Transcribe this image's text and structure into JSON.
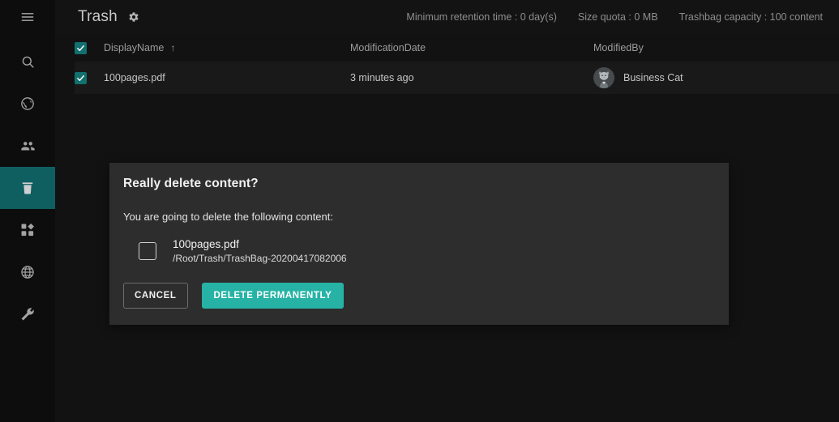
{
  "sidebar": {
    "items": [
      {
        "icon": "hamburger-menu-icon",
        "name": "menu-toggle",
        "label": "Menu",
        "active": false
      },
      {
        "icon": "search-icon",
        "name": "sidebar-item-search",
        "label": "Search",
        "active": false
      },
      {
        "icon": "globe-explore-icon",
        "name": "sidebar-item-explore",
        "label": "Explore",
        "active": false
      },
      {
        "icon": "people-icon",
        "name": "sidebar-item-users",
        "label": "Users",
        "active": false
      },
      {
        "icon": "trash-icon",
        "name": "sidebar-item-trash",
        "label": "Trash",
        "active": true
      },
      {
        "icon": "dashboard-icon",
        "name": "sidebar-item-dashboard",
        "label": "Dashboard",
        "active": false
      },
      {
        "icon": "language-globe-icon",
        "name": "sidebar-item-language",
        "label": "Language",
        "active": false
      },
      {
        "icon": "wrench-icon",
        "name": "sidebar-item-setup",
        "label": "Setup",
        "active": false
      }
    ]
  },
  "header": {
    "title": "Trash",
    "gear_icon": "gear-icon",
    "stats": [
      "Minimum retention time : 0 day(s)",
      "Size quota : 0 MB",
      "Trashbag capacity : 100 content"
    ]
  },
  "table": {
    "columns": {
      "display_name": "DisplayName",
      "modification_date": "ModificationDate",
      "modified_by": "ModifiedBy"
    },
    "sort_indicator": "↑",
    "rows": [
      {
        "checked": true,
        "display_name": "100pages.pdf",
        "modification_date": "3 minutes ago",
        "modified_by": "Business Cat"
      }
    ]
  },
  "dialog": {
    "title": "Really delete content?",
    "subtitle": "You are going to delete the following content:",
    "item": {
      "icon": "file-icon",
      "name": "100pages.pdf",
      "path": "/Root/Trash/TrashBag-20200417082006"
    },
    "cancel_label": "CANCEL",
    "delete_label": "DELETE PERMANENTLY"
  },
  "colors": {
    "accent_teal": "#26b3a6",
    "checkbox_teal": "#12706f",
    "sidebar_active": "#0f5f61",
    "dialog_bg": "#2d2d2d",
    "page_bg": "#121212",
    "sidebar_bg": "#0d0d0d"
  }
}
